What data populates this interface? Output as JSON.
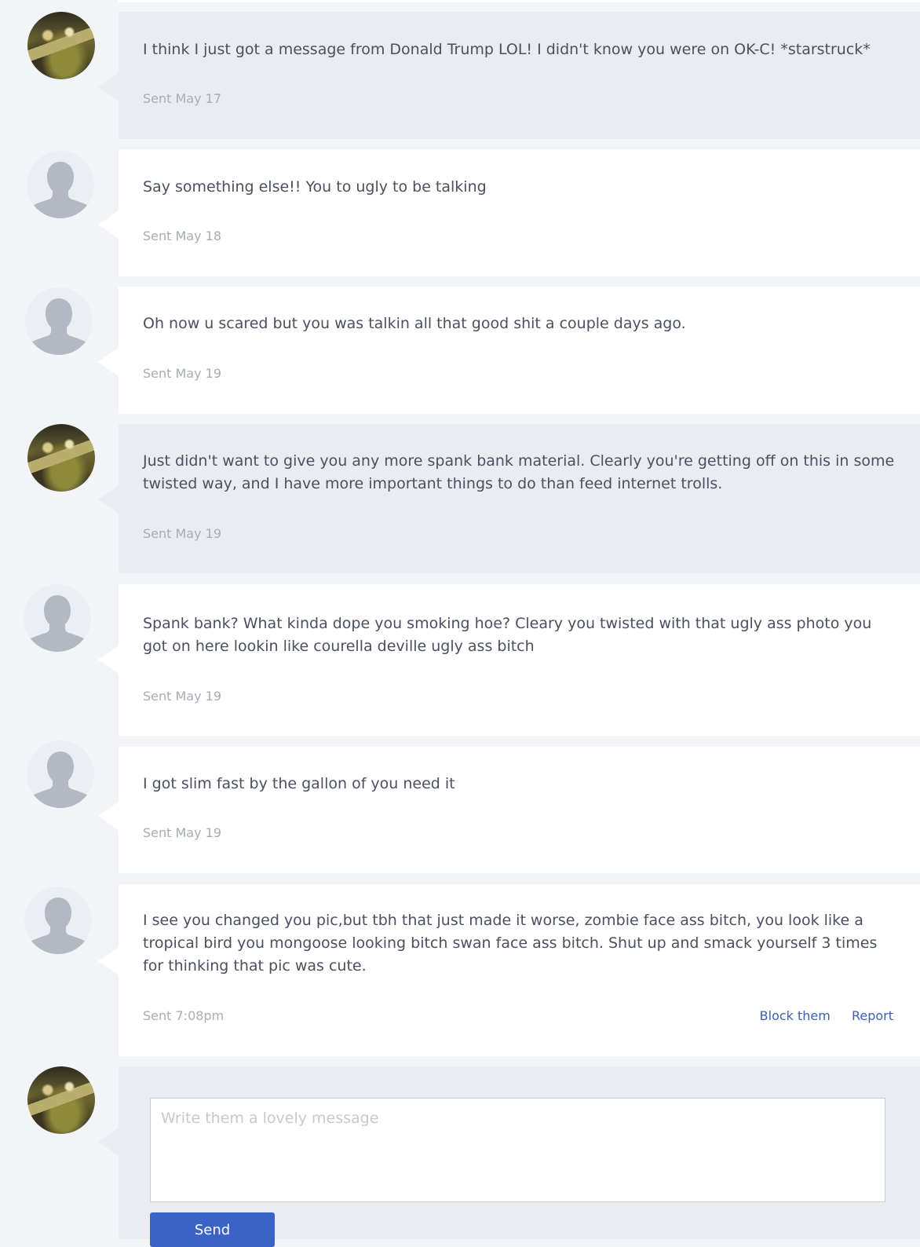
{
  "messages": [
    {
      "sender": "me",
      "avatar": "user-photo",
      "text": "I think I just got a message from Donald Trump LOL! I didn't know you were on OK-C! *starstruck*",
      "sent": "Sent May 17"
    },
    {
      "sender": "them",
      "avatar": "default-silhouette",
      "text": "Say something else!! You to ugly to be talking",
      "sent": "Sent May 18"
    },
    {
      "sender": "them",
      "avatar": "default-silhouette",
      "text": "Oh now u scared but you was talkin all that good shit a couple days ago.",
      "sent": "Sent May 19"
    },
    {
      "sender": "me",
      "avatar": "user-photo",
      "text": "Just didn't want to give you any more spank bank material. Clearly you're getting off on this in some twisted way, and I have more important things to do than feed internet trolls.",
      "sent": "Sent May 19"
    },
    {
      "sender": "them",
      "avatar": "default-silhouette",
      "text": "Spank bank? What kinda dope you smoking hoe? Cleary you twisted with that ugly ass photo you got on here lookin like courella deville ugly ass bitch",
      "sent": "Sent May 19"
    },
    {
      "sender": "them",
      "avatar": "default-silhouette",
      "text": "I got slim fast by the gallon of you need it",
      "sent": "Sent May 19"
    },
    {
      "sender": "them",
      "avatar": "default-silhouette",
      "text": "I see you changed you pic,but tbh that just made it worse, zombie face ass bitch, you look like a tropical bird you mongoose looking bitch swan face ass bitch. Shut up and smack yourself 3 times for thinking that pic was cute.",
      "sent": "Sent 7:08pm",
      "actions": {
        "block_label": "Block them",
        "report_label": "Report"
      }
    }
  ],
  "compose": {
    "placeholder": "Write them a lovely message",
    "send_label": "Send"
  },
  "colors": {
    "page_background": "#f3f4f8",
    "their_bubble": "#ffffff",
    "my_bubble": "#ebecf1",
    "link": "#3d5fb3",
    "send_button": "#3b63c7"
  }
}
